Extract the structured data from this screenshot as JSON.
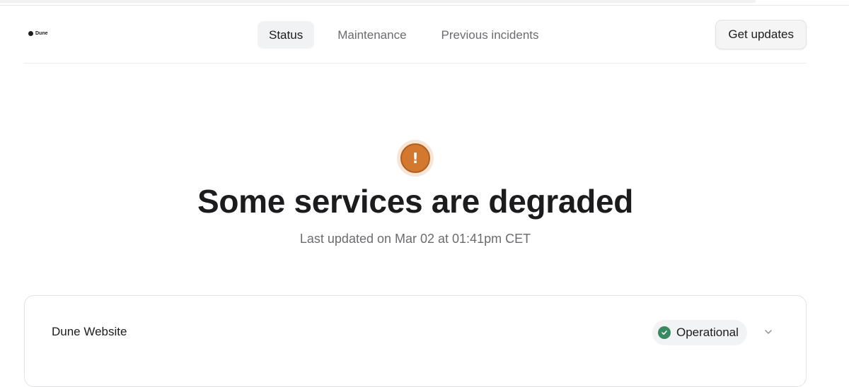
{
  "brand": {
    "name": "Dune"
  },
  "nav": {
    "items": [
      {
        "label": "Status",
        "active": true
      },
      {
        "label": "Maintenance",
        "active": false
      },
      {
        "label": "Previous incidents",
        "active": false
      }
    ]
  },
  "header": {
    "get_updates_label": "Get updates"
  },
  "status": {
    "icon": "exclamation-icon",
    "icon_color": "#d2782f",
    "headline": "Some services are degraded",
    "last_updated": "Last updated on Mar 02 at 01:41pm CET"
  },
  "components": [
    {
      "name": "Dune Website",
      "status": "Operational",
      "status_icon": "check-circle-icon",
      "status_color": "#3a8a61",
      "expand_icon": "chevron-down-icon"
    }
  ]
}
